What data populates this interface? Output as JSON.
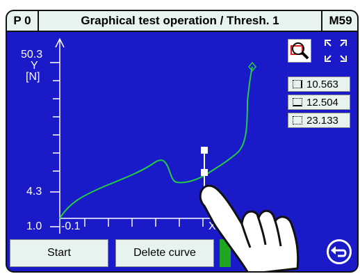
{
  "header": {
    "left": "P 0",
    "title": "Graphical test operation / Thresh. 1",
    "right": "M59"
  },
  "plot": {
    "y_top_label": "50.3",
    "y_axis_name": "Y",
    "y_unit": "[N]",
    "y_mid_label": "4.3",
    "y_bottom_label": "1.0",
    "x_start_label": "-0.1",
    "x_axis_name": "X"
  },
  "values": {
    "v1": "10.563",
    "v2": "12.504",
    "v3": "23.133"
  },
  "buttons": {
    "start": "Start",
    "delete_curve": "Delete curve"
  },
  "colors": {
    "panel": "#1a1ac8",
    "curve": "#22cc44",
    "header_bg": "#e6f3ee",
    "magnifier_red": "#e02020"
  },
  "icons": [
    "magnifier-icon",
    "fullscreen-icon",
    "back-arrow-icon",
    "pointing-hand-icon"
  ]
}
